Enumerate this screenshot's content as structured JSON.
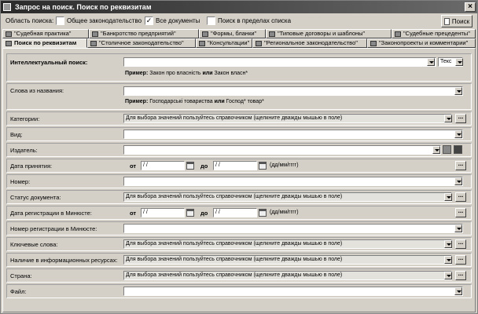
{
  "window": {
    "title": "Запрос на поиск. Поиск по реквизитам"
  },
  "scope": {
    "label": "Область поиска:",
    "options": [
      {
        "label": "Общее законодательство",
        "checked": false
      },
      {
        "label": "Все документы",
        "checked": true
      },
      {
        "label": "Поиск в пределах списка",
        "checked": false
      }
    ],
    "search_button": "Поиск"
  },
  "tabs_row1": [
    "\"Судебная практика\"",
    "\"Банкротство предприятий\"",
    "\"Формы, бланки\"",
    "\"Типовые договоры и шаблоны\"",
    "\"Судебные прецеденты\""
  ],
  "tabs_row2": [
    "Поиск по реквизитам",
    "\"Столичное законодательство\"",
    "\"Консультации\"",
    "\"Региональное законодательство\"",
    "\"Законопроекты и комментарии\""
  ],
  "form": {
    "intellectual": {
      "label": "Интеллектуальный поиск:",
      "lang": "Текс",
      "example_prefix": "Пример:",
      "example_a": "Закон про власність",
      "example_or": "или",
      "example_b": "Закон власн*"
    },
    "title_words": {
      "label": "Слова из названия:",
      "example_prefix": "Пример:",
      "example_a": "Господарські товариства",
      "example_or": "или",
      "example_b": "Господ* товар*"
    },
    "hint": "Для выбора значений пользуйтесь справочником (щелкните дважды мышью в поле)",
    "date_from": "от",
    "date_to": "до",
    "date_placeholder": "/ /",
    "date_format": "(дд/мм/гггг)",
    "labels": {
      "categories": "Категории:",
      "kind": "Вид:",
      "publisher": "Издатель:",
      "adoption_date": "Дата принятия:",
      "number": "Номер:",
      "status": "Статус документа:",
      "reg_date": "Дата регистрации в Минюсте:",
      "reg_number": "Номер регистрации в Минюсте:",
      "keywords": "Ключевые слова:",
      "resources": "Наличие в информационных ресурсах:",
      "country": "Страна:",
      "file": "Файл:"
    },
    "more": "..."
  }
}
